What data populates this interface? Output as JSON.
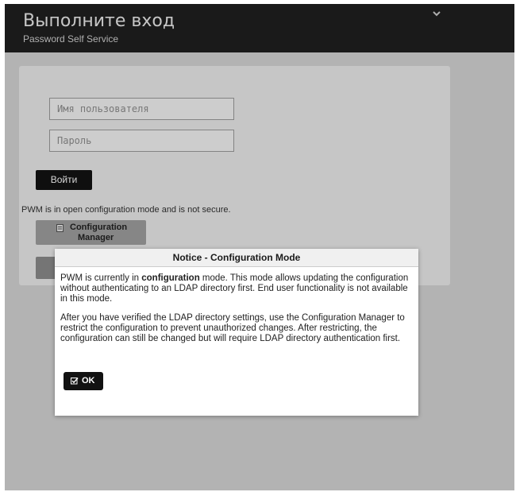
{
  "header": {
    "title": "Выполните вход",
    "subtitle": "Password Self Service"
  },
  "login": {
    "username_placeholder": "Имя пользователя",
    "password_placeholder": "Пароль",
    "login_button": "Войти"
  },
  "config": {
    "warning_text": "PWM is in open configuration mode and is not secure.",
    "config_button_line1": "Configuration",
    "config_button_line2": "Manager"
  },
  "modal": {
    "title": "Notice - Configuration Mode",
    "p1_before": "PWM is currently in ",
    "p1_bold": "configuration",
    "p1_after": " mode. This mode allows updating the configuration without authenticating to an LDAP directory first. End user functionality is not available in this mode.",
    "p2": "After you have verified the LDAP directory settings, use the Configuration Manager to restrict the configuration to prevent unauthorized changes. After restricting, the configuration can still be changed but will require LDAP directory authentication first.",
    "ok_button": "OK"
  },
  "icons": {
    "menu": "chevron-down-icon",
    "config": "document-icon",
    "ok": "checkbox-icon"
  },
  "colors": {
    "header_bg": "#1f1f1f",
    "page_bg": "#d6d6d6",
    "button_dark": "#121212",
    "button_gray": "#a0a0a0"
  }
}
